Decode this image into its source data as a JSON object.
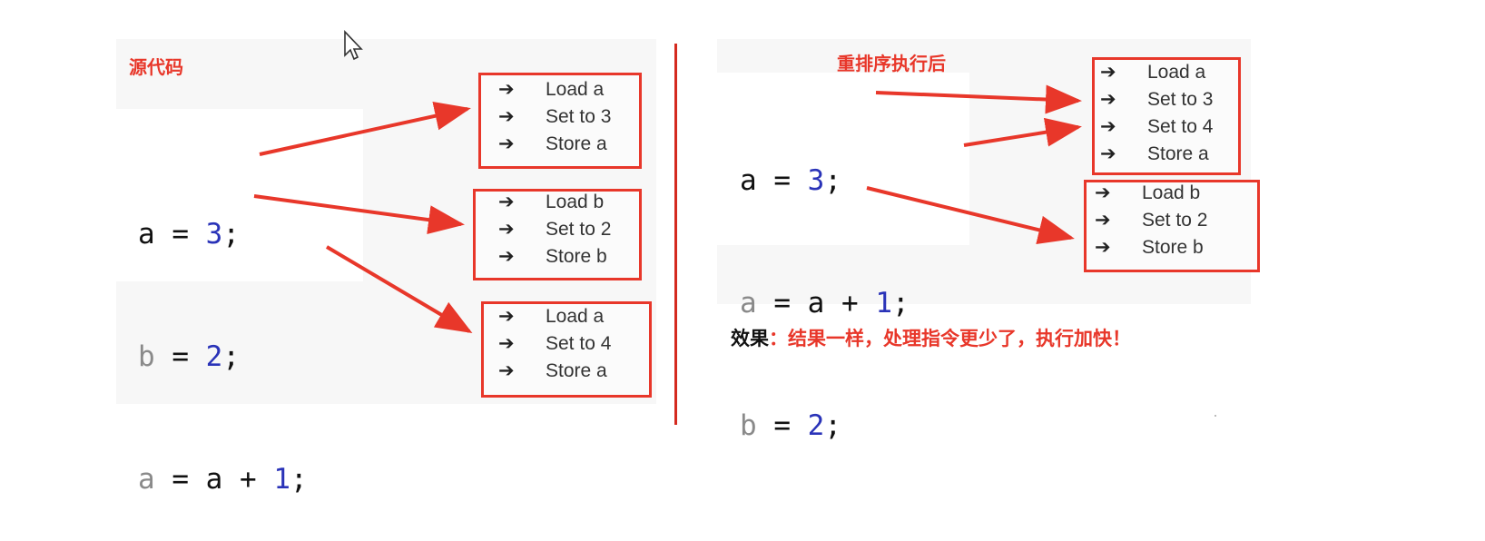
{
  "left": {
    "title": "源代码",
    "code_lines": [
      {
        "var": "a",
        "op": " = ",
        "expr": "",
        "num": "3",
        "end": ";"
      },
      {
        "var": "b",
        "op": " = ",
        "expr": "",
        "num": "2",
        "end": ";"
      },
      {
        "var": "a",
        "op": " = ",
        "expr": "a + ",
        "num": "1",
        "end": ";"
      }
    ],
    "boxes": [
      [
        "Load a",
        "Set to 3",
        "Store a"
      ],
      [
        "Load b",
        "Set to 2",
        "Store b"
      ],
      [
        "Load a",
        "Set to 4",
        "Store a"
      ]
    ]
  },
  "right": {
    "title": "重排序执行后",
    "code_lines": [
      {
        "var": "a",
        "op": " = ",
        "expr": "",
        "num": "3",
        "end": ";"
      },
      {
        "var": "a",
        "op": " = ",
        "expr": "a + ",
        "num": "1",
        "end": ";"
      },
      {
        "var": "b",
        "op": " = ",
        "expr": "",
        "num": "2",
        "end": ";"
      }
    ],
    "boxes": [
      [
        "Load a",
        "Set to 3",
        "Set to 4",
        "Store a"
      ],
      [
        "Load b",
        "Set to 2",
        "Store b"
      ]
    ]
  },
  "note": {
    "label": "效果",
    "colon": "：",
    "text": "结果一样，处理指令更少了，执行加快！"
  },
  "arrow_glyph": "➔",
  "colors": {
    "red": "#e8372a",
    "number_blue": "#2a33b8",
    "gray_var": "#8a8a8a"
  }
}
